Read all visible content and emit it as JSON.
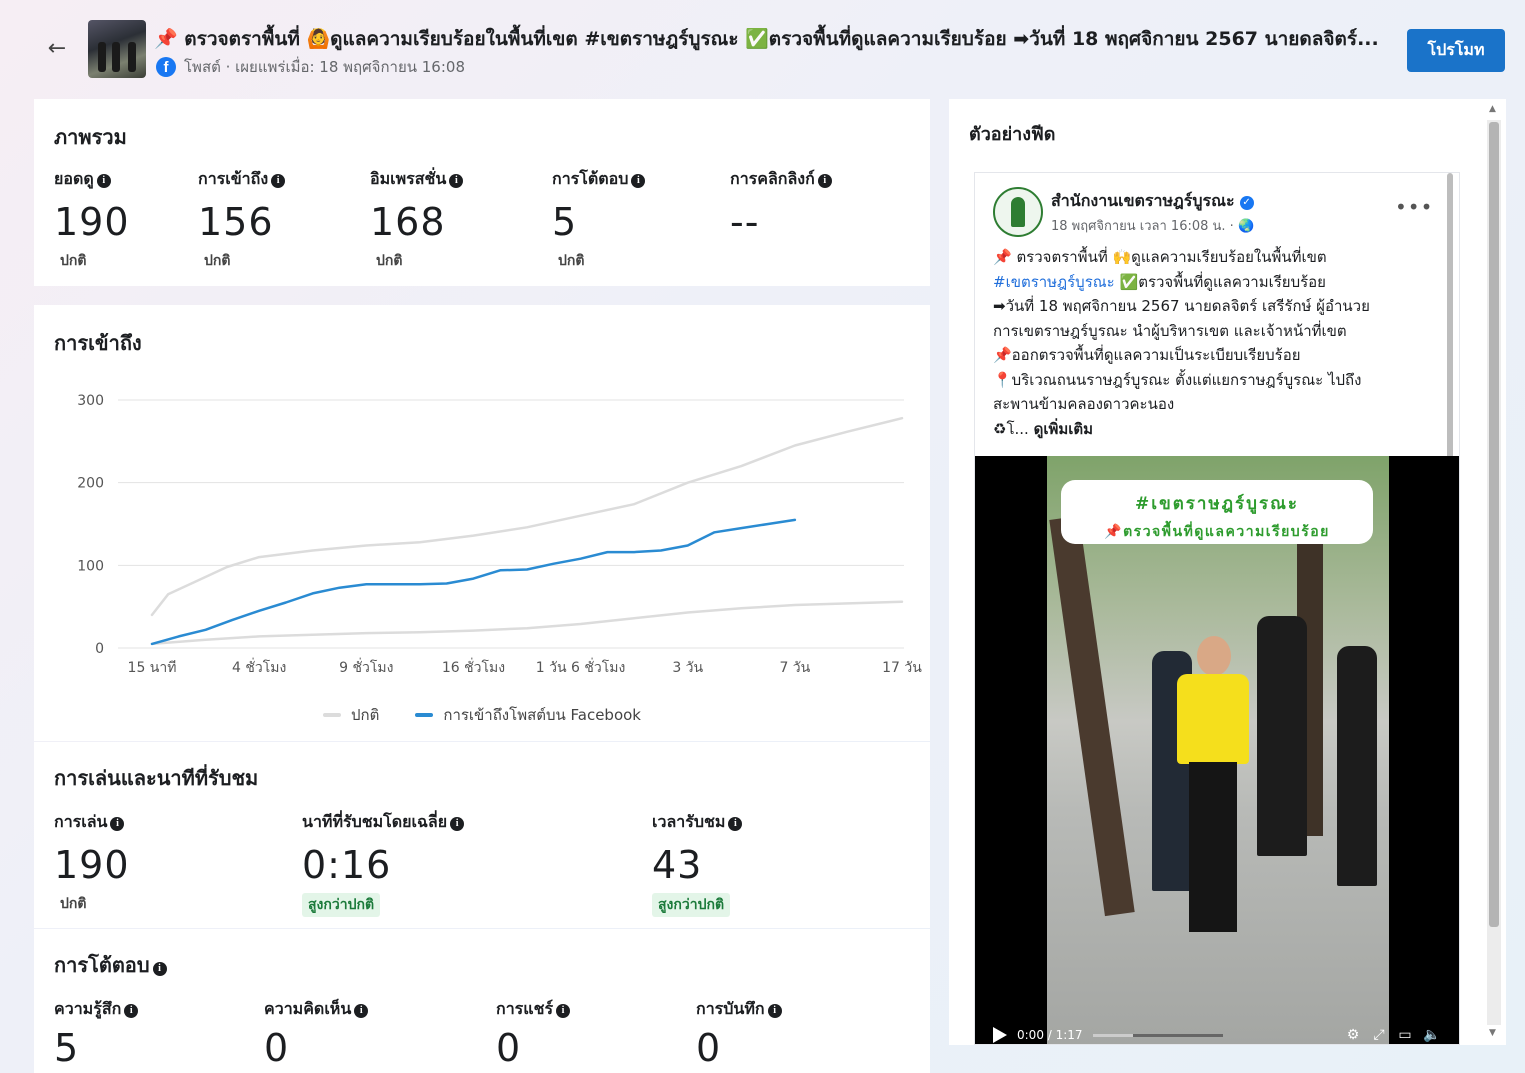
{
  "header": {
    "back_icon": "arrow-left-icon",
    "title": "📌 ตรวจตราพื้นที่ 🙆ดูแลความเรียบร้อยในพื้นที่เขต #เขตราษฎร์บูรณะ ✅ตรวจพื้นที่ดูแลความเรียบร้อย ➡วันที่ 18 พฤศจิกายน 2567 นายดลจิตร์...",
    "meta": "โพสต์ · เผยแพร่เมื่อ: 18 พฤศจิกายน 16:08",
    "promote_label": "โปรโมท"
  },
  "overview": {
    "title": "ภาพรวม",
    "metrics": [
      {
        "label": "ยอดดู",
        "value": "190",
        "sub": "ปกติ"
      },
      {
        "label": "การเข้าถึง",
        "value": "156",
        "sub": "ปกติ"
      },
      {
        "label": "อิมเพรสชั่น",
        "value": "168",
        "sub": "ปกติ"
      },
      {
        "label": "การโต้ตอบ",
        "value": "5",
        "sub": "ปกติ"
      },
      {
        "label": "การคลิกลิงก์",
        "value": "--",
        "sub": ""
      }
    ]
  },
  "reach": {
    "title": "การเข้าถึง",
    "legend_normal": "ปกติ",
    "legend_fb": "การเข้าถึงโพสต์บน Facebook"
  },
  "chart_data": {
    "type": "line",
    "x": [
      "15 นาที",
      "4 ชั่วโมง",
      "9 ชั่วโมง",
      "16 ชั่วโมง",
      "1 วัน 6 ชั่วโมง",
      "3 วัน",
      "7 วัน",
      "17 วัน"
    ],
    "yticks": [
      "300",
      "200",
      "100",
      "0"
    ],
    "ylim": [
      0,
      300
    ],
    "grid": true,
    "legend_position": "bottom",
    "series": [
      {
        "name": "ปกติ",
        "color": "#dcdcdc",
        "band": "upper",
        "x_index": [
          0,
          0.15,
          0.4,
          0.7,
          1.0,
          1.5,
          2.0,
          2.5,
          3.0,
          3.5,
          4.0,
          4.5,
          5.0,
          5.5,
          6.0,
          6.5,
          7.0
        ],
        "values": [
          40,
          65,
          80,
          98,
          110,
          118,
          124,
          128,
          136,
          146,
          160,
          174,
          200,
          220,
          245,
          262,
          278
        ]
      },
      {
        "name": "ปกติ",
        "color": "#dcdcdc",
        "band": "lower",
        "x_index": [
          0,
          0.5,
          1.0,
          1.5,
          2.0,
          2.5,
          3.0,
          3.5,
          4.0,
          4.5,
          5.0,
          5.5,
          6.0,
          6.5,
          7.0
        ],
        "values": [
          5,
          10,
          14,
          16,
          18,
          19,
          21,
          24,
          29,
          36,
          43,
          48,
          52,
          54,
          56
        ]
      },
      {
        "name": "การเข้าถึงโพสต์บน Facebook",
        "color": "#2a8bd2",
        "band": "main",
        "x_index": [
          0,
          0.25,
          0.5,
          0.75,
          1.0,
          1.25,
          1.5,
          1.75,
          2.0,
          2.25,
          2.5,
          2.75,
          3.0,
          3.25,
          3.5,
          3.75,
          4.0,
          4.25,
          4.5,
          4.75,
          5.0,
          5.25,
          5.5,
          5.75,
          6.0
        ],
        "values": [
          5,
          14,
          22,
          34,
          45,
          55,
          66,
          73,
          77,
          77,
          77,
          78,
          84,
          94,
          95,
          102,
          108,
          116,
          116,
          118,
          124,
          140,
          145,
          150,
          155
        ]
      }
    ]
  },
  "plays": {
    "title": "การเล่นและนาทีที่รับชม",
    "metrics": [
      {
        "label": "การเล่น",
        "value": "190",
        "sub": "ปกติ"
      },
      {
        "label": "นาทีที่รับชมโดยเฉลี่ย",
        "value": "0:16",
        "badge": "สูงกว่าปกติ"
      },
      {
        "label": "เวลารับชม",
        "value": "43",
        "badge": "สูงกว่าปกติ"
      }
    ]
  },
  "engagement": {
    "title": "การโต้ตอบ",
    "metrics": [
      {
        "label": "ความรู้สึก",
        "value": "5"
      },
      {
        "label": "ความคิดเห็น",
        "value": "0"
      },
      {
        "label": "การแชร์",
        "value": "0"
      },
      {
        "label": "การบันทึก",
        "value": "0"
      }
    ]
  },
  "feed": {
    "title": "ตัวอย่างฟีด",
    "page_name": "สำนักงานเขตราษฎร์บูรณะ",
    "post_time": "18 พฤศจิกายน เวลา 16:08 น. · 🌏",
    "lines": [
      "📌 ตรวจตราพื้นที่ 🙌ดูแลความเรียบร้อยในพื้นที่เขต",
      "#เขตราษฎร์บูรณะ",
      "✅ตรวจพื้นที่ดูแลความเรียบร้อย",
      "➡วันที่ 18 พฤศจิกายน 2567 นายดลจิตร์ เสรีรักษ์ ผู้อำนวย",
      "การเขตราษฎร์บูรณะ นำผู้บริหารเขต และเจ้าหน้าที่เขต",
      "📌ออกตรวจพื้นที่ดูแลความเป็นระเบียบเรียบร้อย",
      "📍บริเวณถนนราษฎร์บูรณะ ตั้งแต่แยกราษฎร์บูรณะ ไปถึง",
      "สะพานข้ามคลองดาวคะนอง",
      "♻โ...",
      "ดูเพิ่มเติม"
    ],
    "video_banner_1": "#เขตราษฎร์บูรณะ",
    "video_banner_2": "📌ตรวจพื้นที่ดูแลความเรียบร้อย",
    "video_time": "0:00 / 1:17"
  }
}
